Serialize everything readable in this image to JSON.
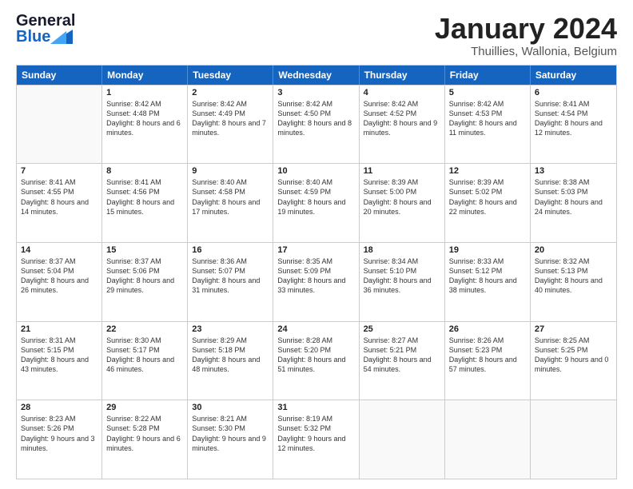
{
  "header": {
    "logo_line1": "General",
    "logo_line2": "Blue",
    "main_title": "January 2024",
    "subtitle": "Thuillies, Wallonia, Belgium"
  },
  "days_of_week": [
    "Sunday",
    "Monday",
    "Tuesday",
    "Wednesday",
    "Thursday",
    "Friday",
    "Saturday"
  ],
  "weeks": [
    [
      {
        "day": "",
        "sunrise": "",
        "sunset": "",
        "daylight": "",
        "empty": true
      },
      {
        "day": "1",
        "sunrise": "Sunrise: 8:42 AM",
        "sunset": "Sunset: 4:48 PM",
        "daylight": "Daylight: 8 hours and 6 minutes."
      },
      {
        "day": "2",
        "sunrise": "Sunrise: 8:42 AM",
        "sunset": "Sunset: 4:49 PM",
        "daylight": "Daylight: 8 hours and 7 minutes."
      },
      {
        "day": "3",
        "sunrise": "Sunrise: 8:42 AM",
        "sunset": "Sunset: 4:50 PM",
        "daylight": "Daylight: 8 hours and 8 minutes."
      },
      {
        "day": "4",
        "sunrise": "Sunrise: 8:42 AM",
        "sunset": "Sunset: 4:52 PM",
        "daylight": "Daylight: 8 hours and 9 minutes."
      },
      {
        "day": "5",
        "sunrise": "Sunrise: 8:42 AM",
        "sunset": "Sunset: 4:53 PM",
        "daylight": "Daylight: 8 hours and 11 minutes."
      },
      {
        "day": "6",
        "sunrise": "Sunrise: 8:41 AM",
        "sunset": "Sunset: 4:54 PM",
        "daylight": "Daylight: 8 hours and 12 minutes."
      }
    ],
    [
      {
        "day": "7",
        "sunrise": "Sunrise: 8:41 AM",
        "sunset": "Sunset: 4:55 PM",
        "daylight": "Daylight: 8 hours and 14 minutes."
      },
      {
        "day": "8",
        "sunrise": "Sunrise: 8:41 AM",
        "sunset": "Sunset: 4:56 PM",
        "daylight": "Daylight: 8 hours and 15 minutes."
      },
      {
        "day": "9",
        "sunrise": "Sunrise: 8:40 AM",
        "sunset": "Sunset: 4:58 PM",
        "daylight": "Daylight: 8 hours and 17 minutes."
      },
      {
        "day": "10",
        "sunrise": "Sunrise: 8:40 AM",
        "sunset": "Sunset: 4:59 PM",
        "daylight": "Daylight: 8 hours and 19 minutes."
      },
      {
        "day": "11",
        "sunrise": "Sunrise: 8:39 AM",
        "sunset": "Sunset: 5:00 PM",
        "daylight": "Daylight: 8 hours and 20 minutes."
      },
      {
        "day": "12",
        "sunrise": "Sunrise: 8:39 AM",
        "sunset": "Sunset: 5:02 PM",
        "daylight": "Daylight: 8 hours and 22 minutes."
      },
      {
        "day": "13",
        "sunrise": "Sunrise: 8:38 AM",
        "sunset": "Sunset: 5:03 PM",
        "daylight": "Daylight: 8 hours and 24 minutes."
      }
    ],
    [
      {
        "day": "14",
        "sunrise": "Sunrise: 8:37 AM",
        "sunset": "Sunset: 5:04 PM",
        "daylight": "Daylight: 8 hours and 26 minutes."
      },
      {
        "day": "15",
        "sunrise": "Sunrise: 8:37 AM",
        "sunset": "Sunset: 5:06 PM",
        "daylight": "Daylight: 8 hours and 29 minutes."
      },
      {
        "day": "16",
        "sunrise": "Sunrise: 8:36 AM",
        "sunset": "Sunset: 5:07 PM",
        "daylight": "Daylight: 8 hours and 31 minutes."
      },
      {
        "day": "17",
        "sunrise": "Sunrise: 8:35 AM",
        "sunset": "Sunset: 5:09 PM",
        "daylight": "Daylight: 8 hours and 33 minutes."
      },
      {
        "day": "18",
        "sunrise": "Sunrise: 8:34 AM",
        "sunset": "Sunset: 5:10 PM",
        "daylight": "Daylight: 8 hours and 36 minutes."
      },
      {
        "day": "19",
        "sunrise": "Sunrise: 8:33 AM",
        "sunset": "Sunset: 5:12 PM",
        "daylight": "Daylight: 8 hours and 38 minutes."
      },
      {
        "day": "20",
        "sunrise": "Sunrise: 8:32 AM",
        "sunset": "Sunset: 5:13 PM",
        "daylight": "Daylight: 8 hours and 40 minutes."
      }
    ],
    [
      {
        "day": "21",
        "sunrise": "Sunrise: 8:31 AM",
        "sunset": "Sunset: 5:15 PM",
        "daylight": "Daylight: 8 hours and 43 minutes."
      },
      {
        "day": "22",
        "sunrise": "Sunrise: 8:30 AM",
        "sunset": "Sunset: 5:17 PM",
        "daylight": "Daylight: 8 hours and 46 minutes."
      },
      {
        "day": "23",
        "sunrise": "Sunrise: 8:29 AM",
        "sunset": "Sunset: 5:18 PM",
        "daylight": "Daylight: 8 hours and 48 minutes."
      },
      {
        "day": "24",
        "sunrise": "Sunrise: 8:28 AM",
        "sunset": "Sunset: 5:20 PM",
        "daylight": "Daylight: 8 hours and 51 minutes."
      },
      {
        "day": "25",
        "sunrise": "Sunrise: 8:27 AM",
        "sunset": "Sunset: 5:21 PM",
        "daylight": "Daylight: 8 hours and 54 minutes."
      },
      {
        "day": "26",
        "sunrise": "Sunrise: 8:26 AM",
        "sunset": "Sunset: 5:23 PM",
        "daylight": "Daylight: 8 hours and 57 minutes."
      },
      {
        "day": "27",
        "sunrise": "Sunrise: 8:25 AM",
        "sunset": "Sunset: 5:25 PM",
        "daylight": "Daylight: 9 hours and 0 minutes."
      }
    ],
    [
      {
        "day": "28",
        "sunrise": "Sunrise: 8:23 AM",
        "sunset": "Sunset: 5:26 PM",
        "daylight": "Daylight: 9 hours and 3 minutes."
      },
      {
        "day": "29",
        "sunrise": "Sunrise: 8:22 AM",
        "sunset": "Sunset: 5:28 PM",
        "daylight": "Daylight: 9 hours and 6 minutes."
      },
      {
        "day": "30",
        "sunrise": "Sunrise: 8:21 AM",
        "sunset": "Sunset: 5:30 PM",
        "daylight": "Daylight: 9 hours and 9 minutes."
      },
      {
        "day": "31",
        "sunrise": "Sunrise: 8:19 AM",
        "sunset": "Sunset: 5:32 PM",
        "daylight": "Daylight: 9 hours and 12 minutes."
      },
      {
        "day": "",
        "sunrise": "",
        "sunset": "",
        "daylight": "",
        "empty": true
      },
      {
        "day": "",
        "sunrise": "",
        "sunset": "",
        "daylight": "",
        "empty": true
      },
      {
        "day": "",
        "sunrise": "",
        "sunset": "",
        "daylight": "",
        "empty": true
      }
    ]
  ]
}
